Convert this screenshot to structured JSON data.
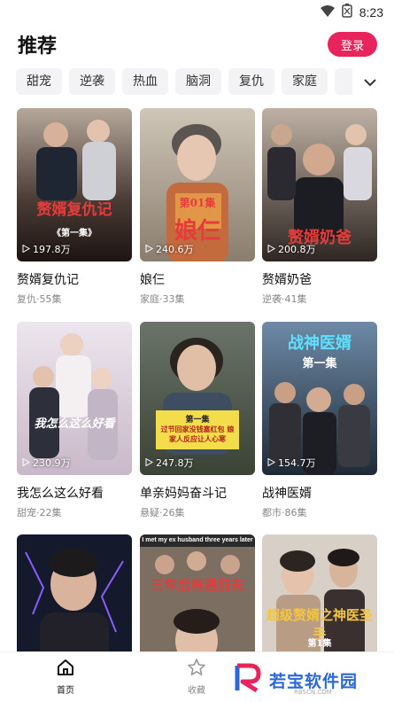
{
  "status": {
    "time": "8:23"
  },
  "header": {
    "title": "推荐",
    "login_label": "登录"
  },
  "tabs": [
    "甜宠",
    "逆袭",
    "热血",
    "脑洞",
    "复仇",
    "家庭"
  ],
  "dramas": [
    {
      "title": "赘婿复仇记",
      "views": "197.8万",
      "genre": "复仇",
      "episodes": "55集",
      "caption": "赘婿复仇记",
      "caption_sub": "《第一集》"
    },
    {
      "title": "娘仨",
      "views": "240.6万",
      "genre": "家庭",
      "episodes": "33集",
      "caption": "娘仨",
      "caption_sub": "第01集"
    },
    {
      "title": "赘婿奶爸",
      "views": "200.8万",
      "genre": "逆袭",
      "episodes": "41集",
      "caption": "赘婿奶爸",
      "caption_sub": ""
    },
    {
      "title": "我怎么这么好看",
      "views": "230.9万",
      "genre": "甜宠",
      "episodes": "22集",
      "caption": "我怎么这么好看",
      "caption_sub": ""
    },
    {
      "title": "单亲妈妈奋斗记",
      "views": "247.8万",
      "genre": "悬疑",
      "episodes": "26集",
      "caption": "过节回家没钱塞红包 娘家人反应让人心寒",
      "caption_sub": "第一集"
    },
    {
      "title": "战神医婿",
      "views": "154.7万",
      "genre": "都市",
      "episodes": "86集",
      "caption": "战神医婿",
      "caption_sub": "第一集"
    },
    {
      "title": "",
      "views": "",
      "genre": "",
      "episodes": "",
      "caption": "",
      "caption_sub": ""
    },
    {
      "title": "",
      "views": "",
      "genre": "",
      "episodes": "",
      "caption": "三年后再遇前夫",
      "caption_sub": "I met my ex husband three years later"
    },
    {
      "title": "",
      "views": "",
      "genre": "",
      "episodes": "",
      "caption": "超级赘婿之神医圣手",
      "caption_sub": "第1集"
    }
  ],
  "nav": {
    "home": "首页",
    "favorites": "收藏"
  },
  "watermark": {
    "text": "若宝软件园",
    "sub": "RBSCN.COM"
  },
  "colors": {
    "accent": "#e8245d",
    "tab_bg": "#f3f3f5"
  }
}
